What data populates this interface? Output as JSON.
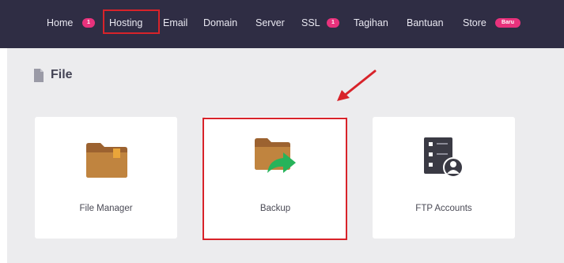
{
  "nav": {
    "items": [
      {
        "label": "Home",
        "badge": "1"
      },
      {
        "label": "Hosting"
      },
      {
        "label": "Email"
      },
      {
        "label": "Domain"
      },
      {
        "label": "Server"
      },
      {
        "label": "SSL",
        "badge": "1"
      },
      {
        "label": "Tagihan"
      },
      {
        "label": "Bantuan"
      },
      {
        "label": "Store",
        "badge": "Baru"
      }
    ]
  },
  "section": {
    "title": "File"
  },
  "cards": [
    {
      "label": "File Manager",
      "icon": "folder-icon"
    },
    {
      "label": "Backup",
      "icon": "folder-backup-icon"
    },
    {
      "label": "FTP Accounts",
      "icon": "ftp-server-icon"
    }
  ],
  "colors": {
    "navbar_bg": "#2f2d44",
    "badge": "#e8327c",
    "highlight": "#d8232a",
    "folder": "#b97a3e",
    "backup_arrow": "#27b35a",
    "content_bg": "#ececee"
  }
}
